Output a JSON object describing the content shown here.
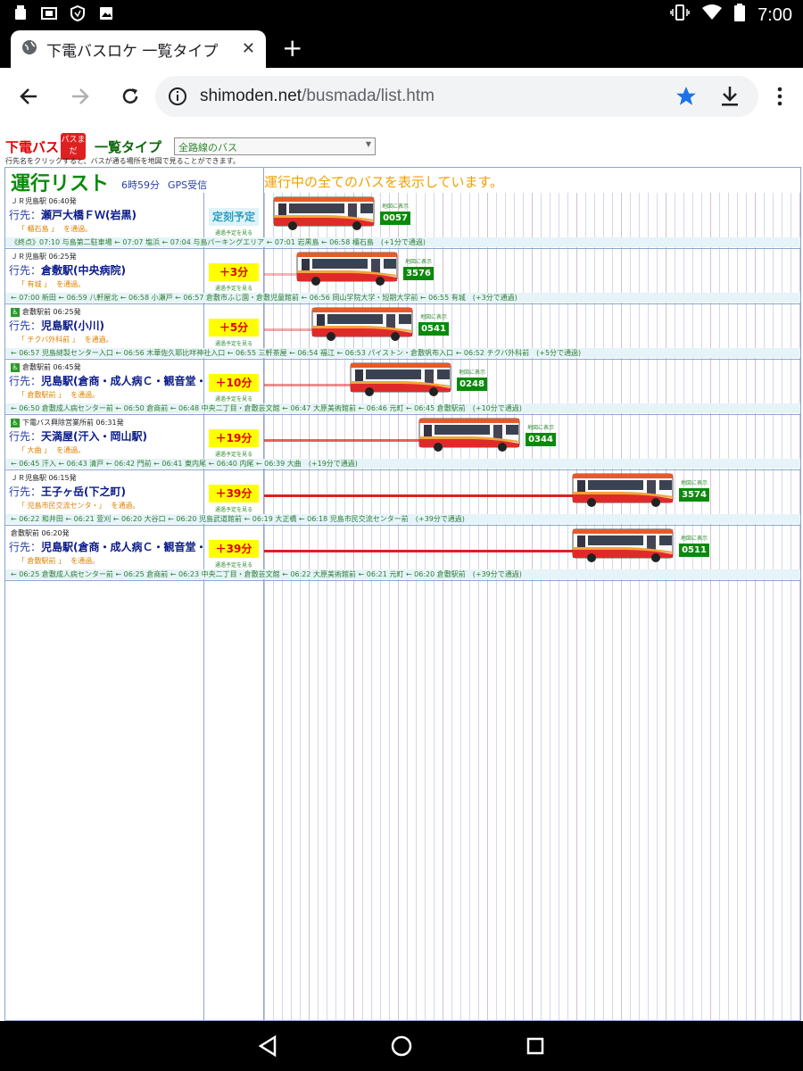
{
  "status_bar": {
    "time": "7:00",
    "left_icons": [
      "sim-icon",
      "photo-icon",
      "shield-icon",
      "image-icon"
    ],
    "right_icons": [
      "vibrate-icon",
      "wifi-icon",
      "battery-icon"
    ]
  },
  "browser": {
    "tab_title": "下電バスロケ 一覧タイプ",
    "url_host": "shimoden.net",
    "url_path": "/busmada/list.htm"
  },
  "page": {
    "brand": "下電バス",
    "logo_text": "バスまだ",
    "list_type": "一覧タイプ",
    "route_select": "全路線のバス",
    "hint": "行先名をクリックすると、バスが通る場所を地図で見ることができます。",
    "list_title": "運行リスト",
    "clock": "6時59分",
    "gps": "GPS受信",
    "banner": "運行中の全てのバスを表示しています。",
    "dest_label": "行先：",
    "via_suffix": "を通過。",
    "map_label": "地図に表示",
    "sched_label": "通過予定を見る"
  },
  "buses": [
    {
      "departure": "ＪＲ児島駅 06:40発",
      "wheelchair": false,
      "destination": "瀬戸大橋ＦＷ(岩黒)",
      "via": "「 櫃石島 」",
      "delay": "定刻予定",
      "on_time": true,
      "delay_minutes": 0,
      "bus_no": "0057",
      "stops": "《終点》07:10 与島第二駐車場 ← 07:07 塩浜 ← 07:04 与島パーキングエリア ← 07:01 岩黒島 ← 06:58 櫃石島　(+1分で通過)"
    },
    {
      "departure": "ＪＲ児島駅 06:25発",
      "wheelchair": false,
      "destination": "倉敷駅(中央病院)",
      "via": "「 有城 」",
      "delay": "＋3分",
      "on_time": false,
      "delay_minutes": 3,
      "bus_no": "3576",
      "stops": "← 07:00 新田 ← 06:59 八軒屋北 ← 06:58 小瀬戸 ← 06:57 倉敷市ふじ園・倉敷児童館前 ← 06:56 岡山学院大学・短期大学前 ← 06:55 有城　(+3分で通過)"
    },
    {
      "departure": "倉敷駅前 06:25発",
      "wheelchair": true,
      "destination": "児島駅(小川)",
      "via": "「 チクバ外科前 」",
      "delay": "＋5分",
      "on_time": false,
      "delay_minutes": 5,
      "bus_no": "0541",
      "stops": "← 06:57 児島縫製センター入口 ← 06:56 木華佐久耶比咩神社入口 ← 06:55 三軒茶屋 ← 06:54 福江 ← 06:53 パイストン・倉敷帆布入口 ← 06:52 チクバ外科前　(+5分で通過)"
    },
    {
      "departure": "倉敷駅前 06:45発",
      "wheelchair": true,
      "destination": "児島駅(倉商・成人病Ｃ・観音堂・",
      "via": "「 倉敷駅前 」",
      "delay": "＋10分",
      "on_time": false,
      "delay_minutes": 10,
      "bus_no": "0248",
      "stops": "← 06:50 倉敷成人病センター前 ← 06:50 倉商前 ← 06:48 中央二丁目・倉敷芸文館 ← 06:47 大原美術館前 ← 06:46 元町 ← 06:45 倉敷駅前　(+10分で通過)"
    },
    {
      "departure": "下電バス興除営業所前 06:31発",
      "wheelchair": true,
      "destination": "天満屋(汗入・岡山駅)",
      "via": "「 大曲 」",
      "delay": "＋19分",
      "on_time": false,
      "delay_minutes": 19,
      "bus_no": "0344",
      "stops": "← 06:45 汗入 ← 06:43 清戸 ← 06:42 門前 ← 06:41 東内尾 ← 06:40 内尾 ← 06:39 大曲　(+19分で通過)"
    },
    {
      "departure": "ＪＲ児島駅 06:15発",
      "wheelchair": false,
      "destination": "王子ヶ岳(下之町)",
      "via": "「 児島市民交流センタ・」",
      "delay": "＋39分",
      "on_time": false,
      "delay_minutes": 39,
      "bus_no": "3574",
      "stops": "← 06:22 和井田 ← 06:21 萱刈 ← 06:20 大谷口 ← 06:20 児島武道館前 ← 06:19 大正橋 ← 06:18 児島市民交流センター前　(+39分で通過)"
    },
    {
      "departure": "倉敷駅前 06:20発",
      "wheelchair": false,
      "destination": "児島駅(倉商・成人病Ｃ・観音堂・",
      "via": "「 倉敷駅前 」",
      "delay": "＋39分",
      "on_time": false,
      "delay_minutes": 39,
      "bus_no": "0511",
      "stops": "← 06:25 倉敷成人病センター前 ← 06:25 倉商前 ← 06:23 中央二丁目・倉敷芸文館 ← 06:22 大原美術館前 ← 06:21 元町 ← 06:20 倉敷駅前　(+39分で通過)"
    }
  ],
  "nav_bar": {
    "buttons": [
      "back-icon",
      "home-icon",
      "recents-icon"
    ]
  },
  "colors": {
    "trail": "#e02020",
    "bus_no_bg": "#0a8a0a",
    "delay_bg": "#ffff00",
    "title_green": "#0a8a0a"
  }
}
